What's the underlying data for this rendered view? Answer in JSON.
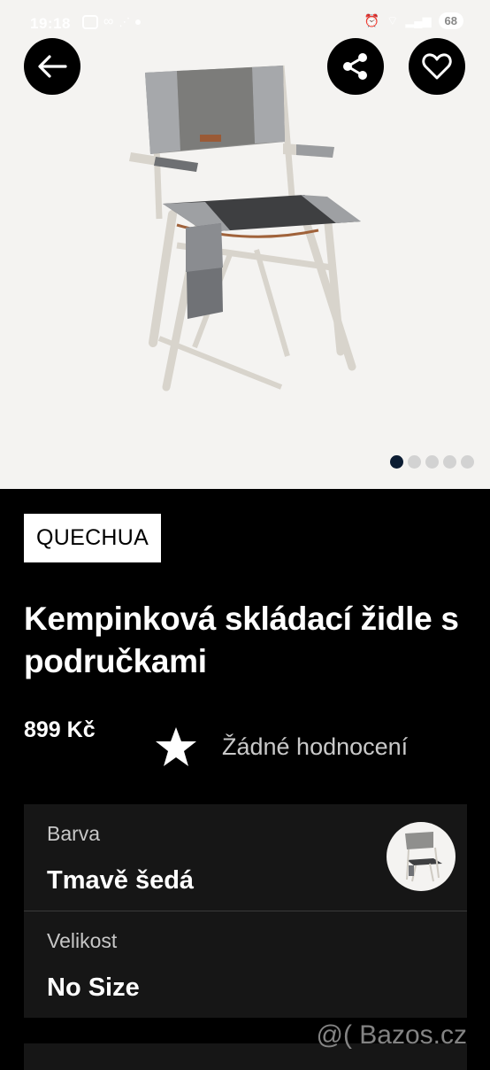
{
  "status_bar": {
    "time": "19:18",
    "battery": "68"
  },
  "product": {
    "brand": "QUECHUA",
    "title": "Kempinková skládací židle s područkami",
    "price": "899 Kč",
    "rating_text": "Žádné hodnocení",
    "gallery": {
      "total": 5,
      "active_index": 0
    }
  },
  "variants": {
    "color_label": "Barva",
    "color_value": "Tmavě šedá",
    "size_label": "Velikost",
    "size_value": "No Size"
  },
  "watermark": "@( Bazos.cz",
  "icons": {
    "back": "arrow-left-icon",
    "share": "share-icon",
    "favorite": "heart-icon",
    "rating": "star-icon"
  },
  "colors": {
    "background": "#000000",
    "image_background": "#f4f3f1",
    "pager_active": "#0c1d33",
    "muted_text": "#c9c9c9"
  }
}
